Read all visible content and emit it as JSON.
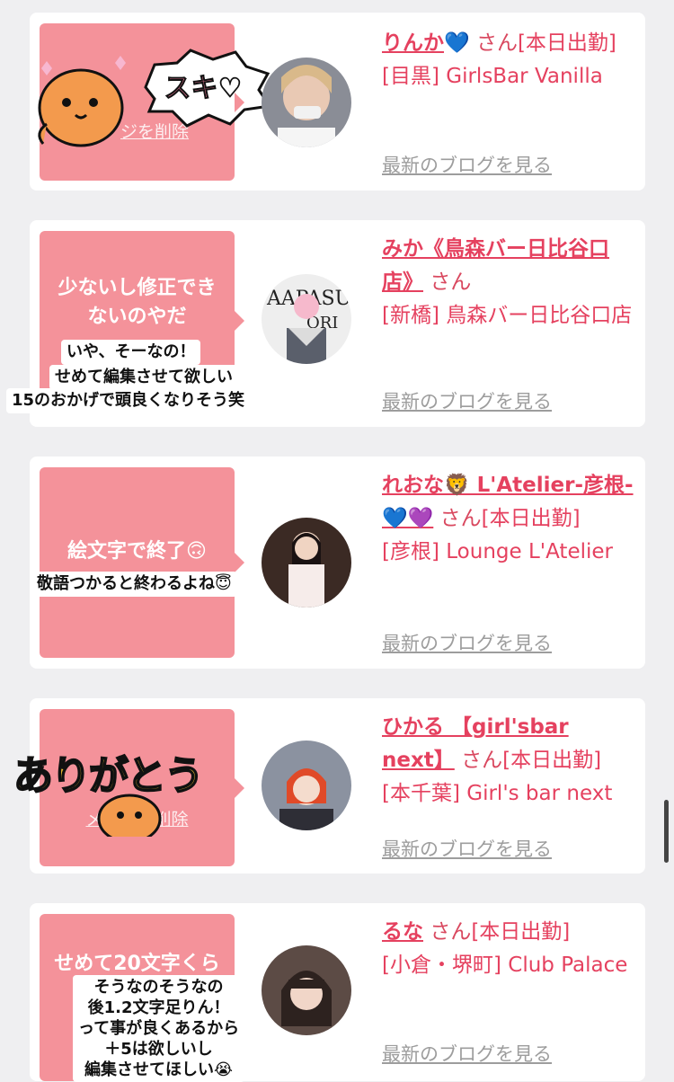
{
  "entries": [
    {
      "bubble_text": "",
      "bubble_link": "ジを削除",
      "sticker_words": "スキ♡",
      "name": "りんか",
      "name_emoji": "💙",
      "san": "さん",
      "status": "[本日出勤]",
      "location": "[目黒] GirlsBar Vanilla",
      "blog_label": "最新のブログを見る"
    },
    {
      "bubble_lines": [
        "少ないし修正でき",
        "ないのやだ"
      ],
      "sticker_lines": [
        "いや、そーなの！",
        "せめて編集させて欲しい",
        "15のおかげで頭良くなりそう笑"
      ],
      "name": "みか《鳥森バー日比谷口店》",
      "san": "さん",
      "location": "[新橋] 鳥森バー日比谷口店",
      "blog_label": "最新のブログを見る"
    },
    {
      "bubble_text": "絵文字で終了🙃",
      "sticker_lines": [
        "敬語つかると終わるよね😇"
      ],
      "name": "れおな🦁 L'Atelier-彦根-💙💜",
      "san": "さん",
      "status": "[本日出勤]",
      "location": "[彦根] Lounge L'Atelier",
      "blog_label": "最新のブログを見る"
    },
    {
      "bubble_link": "メ…ジを削除",
      "sticker_words": "ありがとう",
      "name": "ひかる 【girl'sbar next】",
      "san": "さん",
      "status": "[本日出勤]",
      "location": "[本千葉] Girl's bar next",
      "blog_label": "最新のブログを見る"
    },
    {
      "bubble_text": "せめて20文字くら",
      "sticker_lines": [
        "そうなのそうなの",
        "後1.2文字足りん！",
        "って事が良くあるから",
        "＋5は欲しいし",
        "編集させてほしい😭"
      ],
      "name": "るな",
      "san": "さん",
      "status": "[本日出勤]",
      "location": "[小倉・堺町] Club Palace",
      "blog_label": "最新のブログを見る"
    }
  ],
  "colors": {
    "bubble": "#f4929a",
    "name": "#e5415f",
    "link_gray": "#9d9d9d",
    "background": "#efeff1"
  }
}
